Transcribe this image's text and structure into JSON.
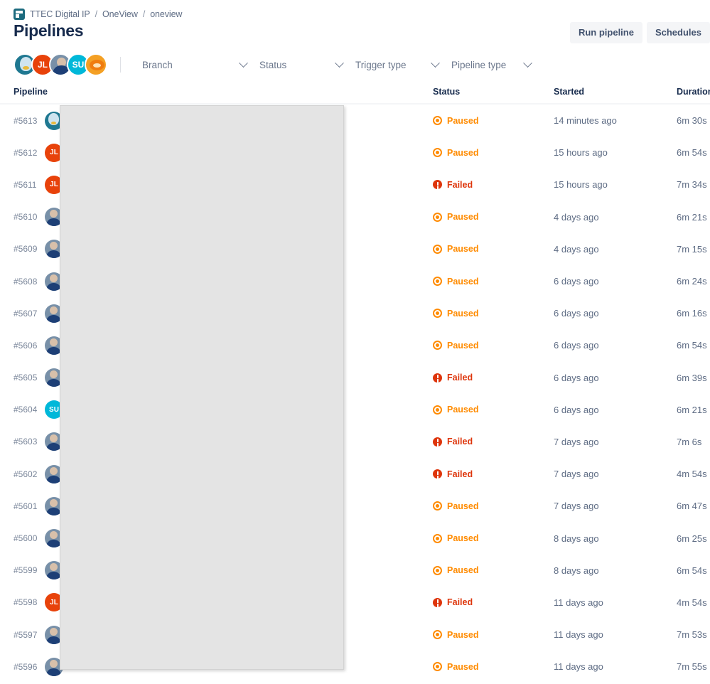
{
  "breadcrumb": {
    "icon": "project-avatar-icon",
    "items": [
      "TTEC Digital IP",
      "OneView",
      "oneview"
    ],
    "separator": "/"
  },
  "header": {
    "title": "Pipelines",
    "actions": [
      {
        "label": "Run pipeline",
        "name": "run-pipeline-button"
      },
      {
        "label": "Schedules",
        "name": "schedules-button"
      }
    ]
  },
  "filters": {
    "avatars": [
      {
        "initials": "",
        "kind": "penguin"
      },
      {
        "initials": "JL",
        "kind": "jl"
      },
      {
        "initials": "",
        "kind": "photo"
      },
      {
        "initials": "SU",
        "kind": "su"
      },
      {
        "initials": "",
        "kind": "garfield"
      }
    ],
    "selects": [
      {
        "label": "Branch",
        "name": "branch-filter"
      },
      {
        "label": "Status",
        "name": "status-filter"
      },
      {
        "label": "Trigger type",
        "name": "trigger-type-filter"
      },
      {
        "label": "Pipeline type",
        "name": "pipeline-type-filter"
      }
    ]
  },
  "table": {
    "columns": {
      "pipeline": "Pipeline",
      "status": "Status",
      "started": "Started",
      "duration": "Duration"
    },
    "rows": [
      {
        "id": "#5613",
        "avatar": "penguin",
        "initials": "",
        "name": "",
        "status": "Paused",
        "status_kind": "paused",
        "started": "14 minutes ago",
        "duration": "6m 30s"
      },
      {
        "id": "#5612",
        "avatar": "jl",
        "initials": "JL",
        "name": "",
        "status": "Paused",
        "status_kind": "paused",
        "started": "15 hours ago",
        "duration": "6m 54s"
      },
      {
        "id": "#5611",
        "avatar": "jl",
        "initials": "JL",
        "name": "",
        "status": "Failed",
        "status_kind": "failed",
        "started": "15 hours ago",
        "duration": "7m 34s"
      },
      {
        "id": "#5610",
        "avatar": "photo",
        "initials": "",
        "name": "",
        "status": "Paused",
        "status_kind": "paused",
        "started": "4 days ago",
        "duration": "6m 21s"
      },
      {
        "id": "#5609",
        "avatar": "photo",
        "initials": "",
        "name": "",
        "status": "Paused",
        "status_kind": "paused",
        "started": "4 days ago",
        "duration": "7m 15s"
      },
      {
        "id": "#5608",
        "avatar": "photo",
        "initials": "",
        "name": "",
        "status": "Paused",
        "status_kind": "paused",
        "started": "6 days ago",
        "duration": "6m 24s"
      },
      {
        "id": "#5607",
        "avatar": "photo",
        "initials": "",
        "name": "",
        "status": "Paused",
        "status_kind": "paused",
        "started": "6 days ago",
        "duration": "6m 16s"
      },
      {
        "id": "#5606",
        "avatar": "photo",
        "initials": "",
        "name": "",
        "status": "Paused",
        "status_kind": "paused",
        "started": "6 days ago",
        "duration": "6m 54s"
      },
      {
        "id": "#5605",
        "avatar": "photo",
        "initials": "",
        "name": "",
        "status": "Failed",
        "status_kind": "failed",
        "started": "6 days ago",
        "duration": "6m 39s"
      },
      {
        "id": "#5604",
        "avatar": "su",
        "initials": "SU",
        "name": "",
        "status": "Paused",
        "status_kind": "paused",
        "started": "6 days ago",
        "duration": "6m 21s"
      },
      {
        "id": "#5603",
        "avatar": "photo",
        "initials": "",
        "name": "",
        "status": "Failed",
        "status_kind": "failed",
        "started": "7 days ago",
        "duration": "7m 6s"
      },
      {
        "id": "#5602",
        "avatar": "photo",
        "initials": "",
        "name": "",
        "status": "Failed",
        "status_kind": "failed",
        "started": "7 days ago",
        "duration": "4m 54s"
      },
      {
        "id": "#5601",
        "avatar": "photo",
        "initials": "",
        "name": "",
        "status": "Paused",
        "status_kind": "paused",
        "started": "7 days ago",
        "duration": "6m 47s"
      },
      {
        "id": "#5600",
        "avatar": "photo",
        "initials": "",
        "name": "",
        "status": "Paused",
        "status_kind": "paused",
        "started": "8 days ago",
        "duration": "6m 25s"
      },
      {
        "id": "#5599",
        "avatar": "photo",
        "initials": "",
        "name": "",
        "status": "Paused",
        "status_kind": "paused",
        "started": "8 days ago",
        "duration": "6m 54s"
      },
      {
        "id": "#5598",
        "avatar": "jl",
        "initials": "JL",
        "name": "",
        "status": "Failed",
        "status_kind": "failed",
        "started": "11 days ago",
        "duration": "4m 54s"
      },
      {
        "id": "#5597",
        "avatar": "photo",
        "initials": "",
        "name": "",
        "status": "Paused",
        "status_kind": "paused",
        "started": "11 days ago",
        "duration": "7m 53s"
      },
      {
        "id": "#5596",
        "avatar": "photo",
        "initials": "",
        "name": "",
        "status": "Paused",
        "status_kind": "paused",
        "started": "11 days ago",
        "duration": "7m 55s"
      }
    ]
  },
  "overlay": {
    "name": "grey-overlay-panel"
  },
  "colors": {
    "paused": "#ff8b00",
    "failed": "#de350b",
    "link": "#0052cc",
    "text": "#172b4d",
    "muted": "#5e6c84",
    "button_bg": "#f4f5f7"
  }
}
